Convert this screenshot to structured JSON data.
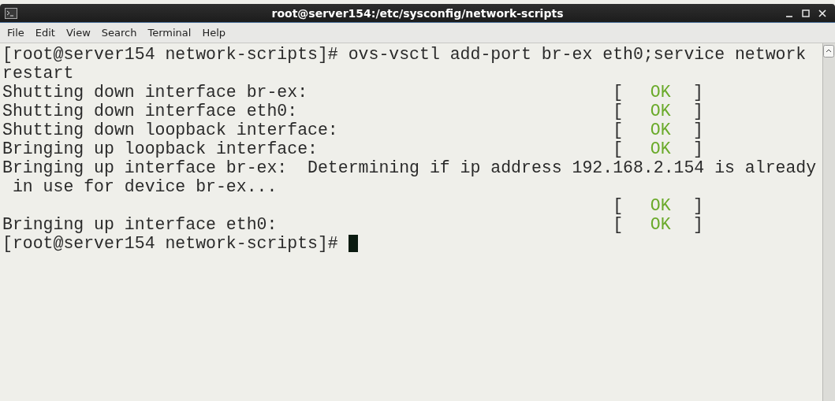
{
  "window": {
    "title": "root@server154:/etc/sysconfig/network-scripts"
  },
  "menu": [
    "File",
    "Edit",
    "View",
    "Search",
    "Terminal",
    "Help"
  ],
  "terminal": {
    "lines": [
      {
        "kind": "text",
        "text": "[root@server154 network-scripts]# ovs-vsctl add-port br-ex eth0;service network"
      },
      {
        "kind": "text",
        "text": "restart"
      },
      {
        "kind": "status",
        "text": "Shutting down interface br-ex:",
        "open": "[",
        "status": "OK",
        "close": "]"
      },
      {
        "kind": "status",
        "text": "Shutting down interface eth0:",
        "open": "[",
        "status": "OK",
        "close": "]"
      },
      {
        "kind": "status",
        "text": "Shutting down loopback interface:",
        "open": "[",
        "status": "OK",
        "close": "]"
      },
      {
        "kind": "status",
        "text": "Bringing up loopback interface:",
        "open": "[",
        "status": "OK",
        "close": "]"
      },
      {
        "kind": "text",
        "text": "Bringing up interface br-ex:  Determining if ip address 192.168.2.154 is already"
      },
      {
        "kind": "text",
        "text": " in use for device br-ex..."
      },
      {
        "kind": "status",
        "open": "[",
        "status": "OK",
        "close": "]"
      },
      {
        "kind": "status",
        "text": "Bringing up interface eth0:",
        "open": "[",
        "status": "OK",
        "close": "]"
      },
      {
        "kind": "prompt",
        "text": "[root@server154 network-scripts]# "
      }
    ]
  }
}
